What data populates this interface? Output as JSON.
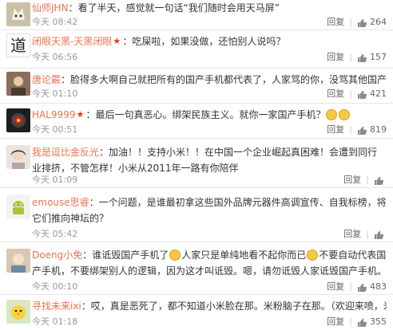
{
  "labels": {
    "reply": "回复"
  },
  "comments": [
    {
      "user": "仙师JHN",
      "text": "：看了半天，感觉就一句话“我们随时会用天马屏”",
      "time": "今天 08:42",
      "likes": "264",
      "avatar_icon": "fox-avatar-icon"
    },
    {
      "user": "闭眼天黑-天黑闭眼",
      "vip": true,
      "text": "：吃屎啦，如果没做，还怕别人说吗？",
      "time": "今天 06:56",
      "likes": "157",
      "avatar_icon": "dao-character-avatar-icon",
      "avatar_glyph": "道"
    },
    {
      "user": "唐论霰",
      "text": "：脸得多大啊自己就把所有的国产手机都代表了，人家骂的你，没骂其他国产手机",
      "time": "今天 01:10",
      "likes": "421",
      "avatar_icon": "portrait-avatar-icon"
    },
    {
      "user": "HAL9999",
      "vip": true,
      "text": "：最后一句真恶心。绑架民族主义。就你一家国产手机？",
      "emojis": 2,
      "time": "今天 00:51",
      "likes": "819",
      "avatar_icon": "hal-eye-avatar-icon"
    },
    {
      "user": "我是逗比金反光",
      "text": "：加油！！支持小米！！在中国一个企业崛起真困难！会遭到同行业排挤，不管怎样！小米从2011年一路有你陪伴",
      "time": "今天 01:09",
      "likes": "",
      "avatar_icon": "girl-avatar-icon"
    },
    {
      "user": "emouse思睿",
      "text": "：一个问题，是谁最初拿这些国外品牌元器件高调宣传、自我标榜，将它们推向神坛的？",
      "time": "今天 05:42",
      "likes": "",
      "avatar_icon": "android-avatar-icon"
    },
    {
      "user": "Doeng小免",
      "seg1": "：谁诋毁国产手机了",
      "seg2": "人家只是单纯地看不起你而已",
      "seg3": "不要自动代表国产手机，不要绑架别人的逻辑，因为这才叫诋毁。嗯，请勿诋毁人家诋毁国产手机。",
      "time": "今天 00:10",
      "likes": "483",
      "avatar_icon": "mixed-avatar-icon"
    },
    {
      "user": "寻找未来ixi",
      "text": "：哎，真是恶死了，都不知道小米脸在那。米粉脑子在那。（欢迎来喷，米狗们）",
      "time": "今天 01:18",
      "likes": "355",
      "avatar_icon": "chick-avatar-icon"
    }
  ],
  "colors": {
    "username": "#eb7350",
    "meta": "#999999",
    "divider": "#e6e6e6"
  }
}
